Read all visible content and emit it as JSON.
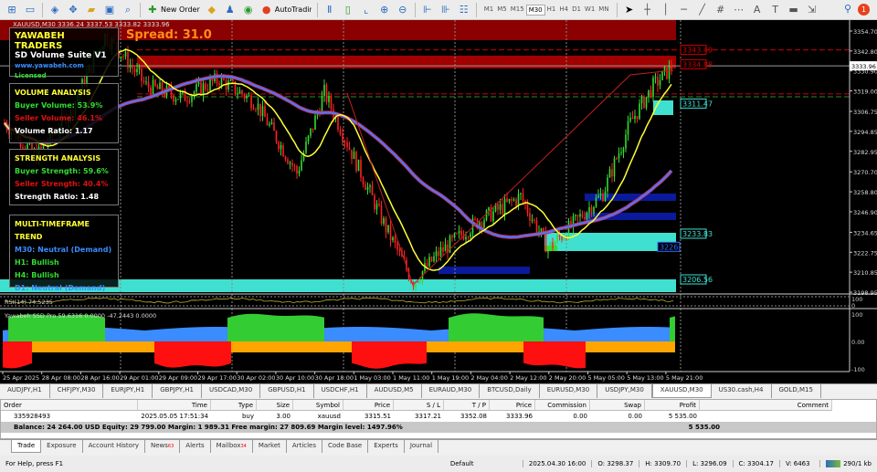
{
  "toolbar": {
    "new_order": "New Order",
    "autotrading": "AutoTrading",
    "timeframes": [
      "M1",
      "M5",
      "M15",
      "M30",
      "H1",
      "H4",
      "D1",
      "W1",
      "MN"
    ],
    "active_tf": "M30",
    "notifications": "1"
  },
  "chart": {
    "title": "XAUUSD,M30  3336.24 3337.53 3333.82 3333.96",
    "spread": "Spread: 31.0",
    "brand": {
      "name": "YAWABEH TRADERS",
      "product": "SD Volume Suite V1",
      "url": "www.yawabeh.com",
      "license": "Licensed"
    },
    "volume": {
      "title": "VOLUME ANALYSIS",
      "buyer": "Buyer Volume: 53.9%",
      "seller": "Seller Volume: 46.1%",
      "ratio": "Volume Ratio: 1.17"
    },
    "strength": {
      "title": "STRENGTH ANALYSIS",
      "buyer": "Buyer Strength: 59.6%",
      "seller": "Seller Strength: 40.4%",
      "ratio": "Strength Ratio: 1.48"
    },
    "mtf": {
      "title": "MULTI-TIMEFRAME TREND",
      "m30": "M30: Neutral (Demand)",
      "h1": "H1: Bullish",
      "h4": "H4: Bullish",
      "d1": "D1: Neutral (Demand)"
    },
    "price_axis": [
      "3354.70",
      "3342.80",
      "3330.90",
      "3319.00",
      "3306.75",
      "3294.85",
      "3282.95",
      "3270.70",
      "3258.80",
      "3246.90",
      "3234.65",
      "3222.75",
      "3210.85",
      "3198.95"
    ],
    "current_price": "3333.96",
    "level_labels": [
      "3343.49",
      "3334.88",
      "3311.47",
      "3233.83",
      "3226.",
      "3206.56"
    ],
    "rsi_label": "RSI(14) 74.5235",
    "rsi_axis": [
      "100",
      "0"
    ],
    "ssd_label": "Yawabeh SSD Pro 59.6316 0.0000 -47.2443 0.0000",
    "ssd_axis": [
      "100",
      "0.00",
      "-100"
    ],
    "time_axis": [
      "25 Apr 2025",
      "28 Apr 08:00",
      "28 Apr 16:00",
      "29 Apr 01:00",
      "29 Apr 09:00",
      "29 Apr 17:00",
      "30 Apr 02:00",
      "30 Apr 10:00",
      "30 Apr 18:00",
      "1 May 03:00",
      "1 May 11:00",
      "1 May 19:00",
      "2 May 04:00",
      "2 May 12:00",
      "2 May 20:00",
      "5 May 05:00",
      "5 May 13:00",
      "5 May 21:00"
    ]
  },
  "chart_tabs": [
    "AUDJPY,H1",
    "CHFJPY,M30",
    "EURJPY,H1",
    "GBPJPY,H1",
    "USDCAD,M30",
    "GBPUSD,H1",
    "USDCHF,H1",
    "AUDUSD,M5",
    "EURAUD,M30",
    "BTCUSD,Daily",
    "EURUSD,M30",
    "USDJPY,M30",
    "XAUUSD,M30",
    "US30.cash,H4",
    "GOLD,M15"
  ],
  "active_chart_tab": "XAUUSD,M30",
  "terminal": {
    "columns": [
      "Order",
      "Time",
      "Type",
      "Size",
      "Symbol",
      "Price",
      "S / L",
      "T / P",
      "Price",
      "Commission",
      "Swap",
      "Profit",
      "Comment"
    ],
    "rows": [
      [
        "335928493",
        "2025.05.05 17:51:34",
        "buy",
        "3.00",
        "xauusd",
        "3315.51",
        "3317.21",
        "3352.08",
        "3333.96",
        "0.00",
        "0.00",
        "5 535.00",
        ""
      ]
    ],
    "balance": "Balance: 24 264.00 USD  Equity: 29 799.00  Margin: 1 989.31  Free margin: 27 809.69  Margin level: 1497.96%",
    "total_profit": "5 535.00",
    "tabs": [
      {
        "label": "Trade"
      },
      {
        "label": "Exposure"
      },
      {
        "label": "Account History"
      },
      {
        "label": "News",
        "badge": "63"
      },
      {
        "label": "Alerts"
      },
      {
        "label": "Mailbox",
        "badge": "34"
      },
      {
        "label": "Market"
      },
      {
        "label": "Articles"
      },
      {
        "label": "Code Base"
      },
      {
        "label": "Experts"
      },
      {
        "label": "Journal"
      }
    ]
  },
  "status": {
    "help": "For Help, press F1",
    "profile": "Default",
    "datetime": "2025.04.30 16:00",
    "open": "O: 3298.37",
    "high": "H: 3309.70",
    "low": "L: 3296.09",
    "close": "C: 3304.17",
    "volume": "V: 6463",
    "traffic": "290/1 kb"
  },
  "colors": {
    "bull": "#33dd33",
    "bear": "#ff2020",
    "ma_fast": "#ffff33",
    "ma_slow": "#4a78ff",
    "supply": "#8b0000",
    "demand": "#40e0d0"
  }
}
